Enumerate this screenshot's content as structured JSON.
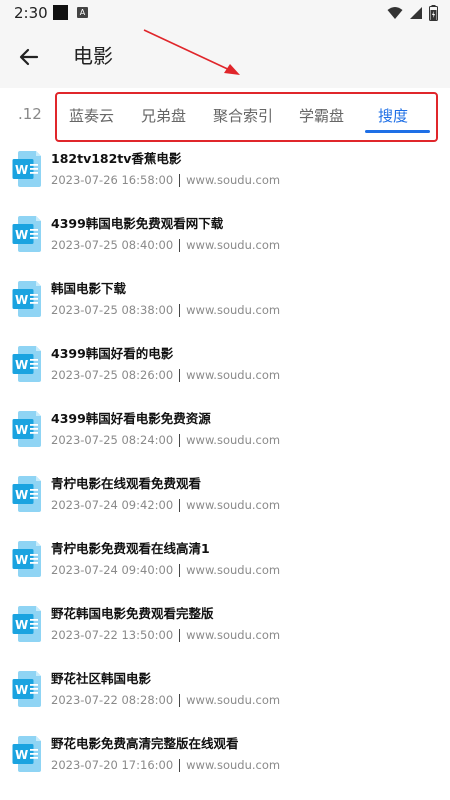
{
  "status_bar": {
    "time": "2:30",
    "notif_letter": "A"
  },
  "header": {
    "title": "电影",
    "back_icon": "arrow-left-icon"
  },
  "tabs": {
    "partial_prev": ".12",
    "items": [
      {
        "label": "蓝奏云",
        "active": false
      },
      {
        "label": "兄弟盘",
        "active": false
      },
      {
        "label": "聚合索引",
        "active": false
      },
      {
        "label": "学霸盘",
        "active": false
      },
      {
        "label": "搜度",
        "active": true
      }
    ],
    "accent_color": "#1e6fe6",
    "highlight_color": "#e0262b"
  },
  "results": [
    {
      "title": "182tv182tv香蕉电影",
      "date": "2023-07-26 16:58:00",
      "source": "www.soudu.com"
    },
    {
      "title": "4399韩国电影免费观看网下载",
      "date": "2023-07-25 08:40:00",
      "source": "www.soudu.com"
    },
    {
      "title": "韩国电影下载",
      "date": "2023-07-25 08:38:00",
      "source": "www.soudu.com"
    },
    {
      "title": "4399韩国好看的电影",
      "date": "2023-07-25 08:26:00",
      "source": "www.soudu.com"
    },
    {
      "title": "4399韩国好看电影免费资源",
      "date": "2023-07-25 08:24:00",
      "source": "www.soudu.com"
    },
    {
      "title": "青柠电影在线观看免费观看",
      "date": "2023-07-24 09:42:00",
      "source": "www.soudu.com"
    },
    {
      "title": "青柠电影免费观看在线高清1",
      "date": "2023-07-24 09:40:00",
      "source": "www.soudu.com"
    },
    {
      "title": "野花韩国电影免费观看完整版",
      "date": "2023-07-22 13:50:00",
      "source": "www.soudu.com"
    },
    {
      "title": "野花社区韩国电影",
      "date": "2023-07-22 08:28:00",
      "source": "www.soudu.com"
    },
    {
      "title": "野花电影免费高清完整版在线观看",
      "date": "2023-07-20 17:16:00",
      "source": "www.soudu.com"
    }
  ],
  "file_icon": "word-document-icon"
}
